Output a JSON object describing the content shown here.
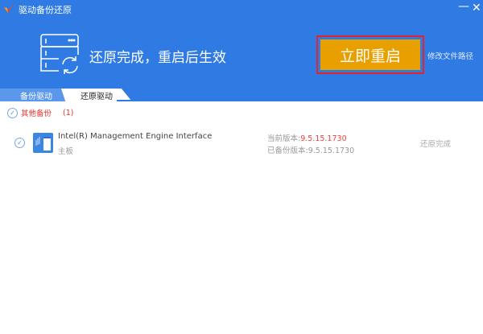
{
  "window": {
    "title": "驱动备份还原",
    "minimize": "—",
    "close": "✕"
  },
  "hero": {
    "message": "还原完成，重启后生效",
    "restart_button": "立即重启",
    "change_path_link": "修改文件路径"
  },
  "tabs": [
    {
      "label": "备份驱动",
      "active": false
    },
    {
      "label": "还原驱动",
      "active": true
    }
  ],
  "group": {
    "label": "其他备份",
    "count": "(1)"
  },
  "drivers": [
    {
      "name": "Intel(R) Management Engine Interface",
      "category": "主板",
      "current_label": "当前版本:",
      "current_version": "9.5.15.1730",
      "backup_label": "已备份版本:",
      "backup_version": "9.5.15.1730",
      "status": "还原完成"
    }
  ],
  "colors": {
    "brand": "#2f7be3",
    "button": "#e8a000",
    "alert": "#e3242b"
  }
}
